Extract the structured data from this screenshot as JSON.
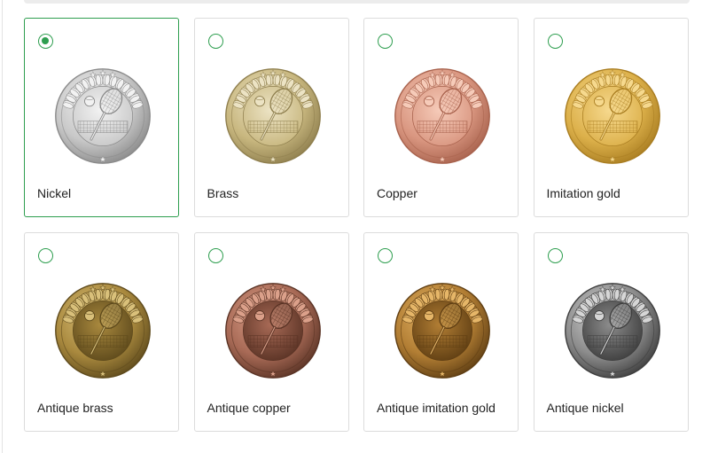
{
  "selected_index": 0,
  "options": [
    {
      "label": "Nickel",
      "icon": "tennis-medal-icon",
      "finish": "bright",
      "colors": {
        "light": "#f2f2f2",
        "mid": "#c8c8c8",
        "dark": "#8a8a8a"
      }
    },
    {
      "label": "Brass",
      "icon": "tennis-medal-icon",
      "finish": "bright",
      "colors": {
        "light": "#ece3c4",
        "mid": "#c8b77f",
        "dark": "#8f7f4e"
      }
    },
    {
      "label": "Copper",
      "icon": "tennis-medal-icon",
      "finish": "bright",
      "colors": {
        "light": "#f6cbb9",
        "mid": "#d99680",
        "dark": "#a8624d"
      }
    },
    {
      "label": "Imitation gold",
      "icon": "tennis-medal-icon",
      "finish": "bright",
      "colors": {
        "light": "#f6d98e",
        "mid": "#dcb04a",
        "dark": "#a97d21"
      }
    },
    {
      "label": "Antique brass",
      "icon": "tennis-medal-icon",
      "finish": "antique",
      "colors": {
        "light": "#d9c07a",
        "mid": "#a9893e",
        "dark": "#5e4a1c"
      }
    },
    {
      "label": "Antique copper",
      "icon": "tennis-medal-icon",
      "finish": "antique",
      "colors": {
        "light": "#dba08a",
        "mid": "#a86a56",
        "dark": "#5a3325"
      }
    },
    {
      "label": "Antique imitation gold",
      "icon": "tennis-medal-icon",
      "finish": "antique",
      "colors": {
        "light": "#e6b668",
        "mid": "#b27e34",
        "dark": "#5f3e13"
      }
    },
    {
      "label": "Antique nickel",
      "icon": "tennis-medal-icon",
      "finish": "antique",
      "colors": {
        "light": "#d6d6d6",
        "mid": "#8c8c8c",
        "dark": "#3e3e3e"
      }
    }
  ],
  "accent_color": "#2e9e4f"
}
